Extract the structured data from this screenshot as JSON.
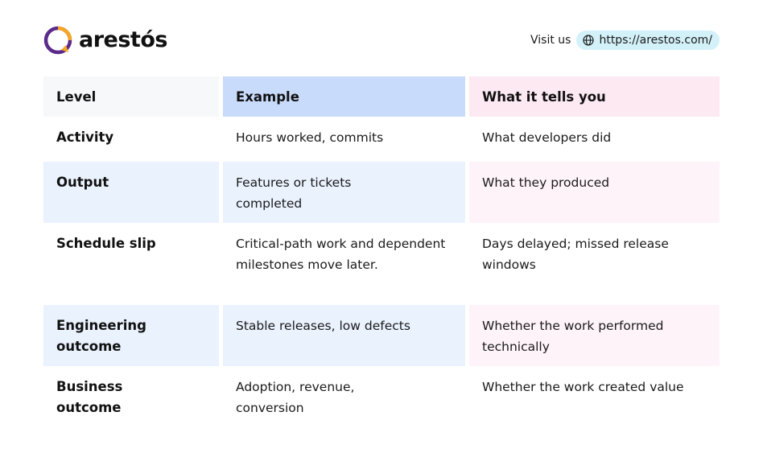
{
  "brand": {
    "name": "arestós",
    "accent_purple": "#5b2b8c",
    "accent_orange": "#f5a623"
  },
  "visit": {
    "label": "Visit us",
    "url": "https://arestos.com/",
    "icon": "globe-icon"
  },
  "table": {
    "headers": [
      "Level",
      "Example",
      "What it tells you"
    ],
    "rows": [
      [
        "Activity",
        "Hours worked, commits",
        "What developers did"
      ],
      [
        "Output",
        "Features or tickets completed",
        "What they produced"
      ],
      [
        "Schedule slip",
        "Critical-path work and dependent milestones move later.",
        "Days delayed; missed release windows"
      ],
      [
        "Engineering outcome",
        "Stable releases, low defects",
        "Whether the work performed technically"
      ],
      [
        "Business outcome",
        "Adoption, revenue, conversion",
        "Whether the work created value"
      ]
    ]
  }
}
